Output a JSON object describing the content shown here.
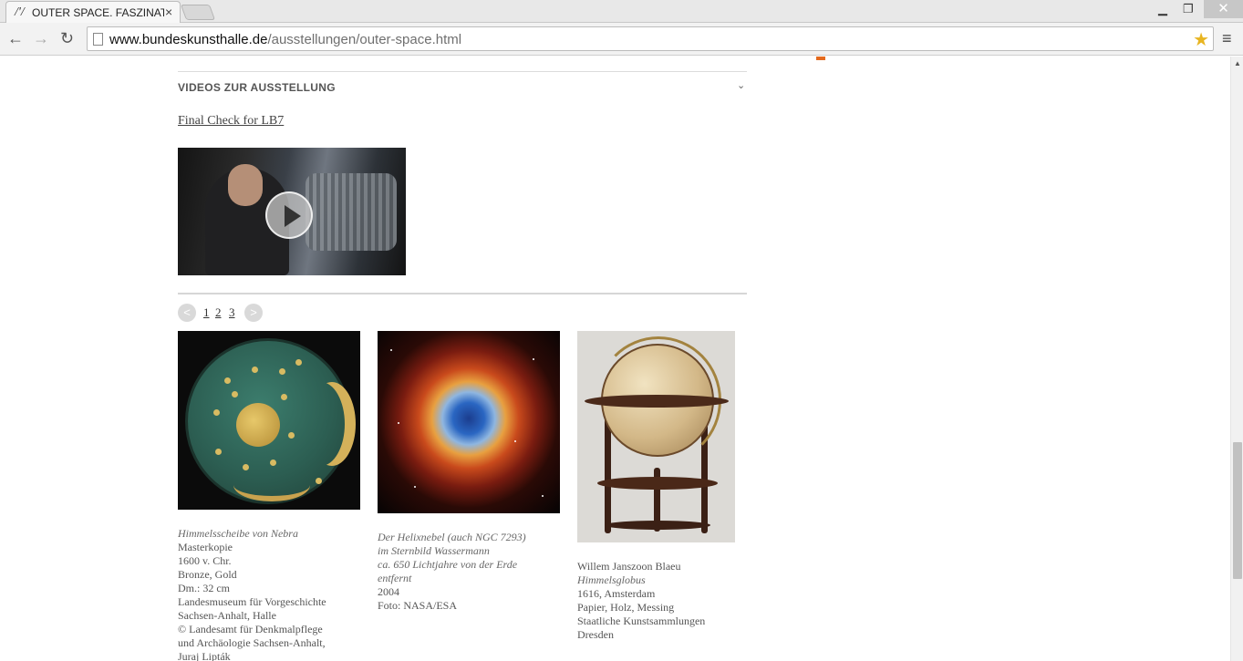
{
  "browser": {
    "tab_title": "OUTER SPACE. FASZINATI",
    "tab_favicon": "/'/",
    "url_host": "www.bundeskunsthalle.de",
    "url_path": "/ausstellungen/outer-space.html"
  },
  "section": {
    "title": "VIDEOS ZUR AUSSTELLUNG",
    "video_link": "Final Check for LB7"
  },
  "pager": {
    "prev": "<",
    "next": ">",
    "pages": [
      "1",
      "2",
      "3"
    ]
  },
  "artworks": [
    {
      "lines_italic": [
        "Himmelsscheibe von Nebra"
      ],
      "lines": [
        "Masterkopie",
        "1600 v. Chr.",
        "Bronze, Gold",
        "Dm.: 32 cm",
        "Landesmuseum für Vorgeschichte",
        "Sachsen-Anhalt, Halle",
        "© Landesamt für Denkmalpflege",
        "und Archäologie Sachsen-Anhalt,",
        "Juraj  Lipták"
      ]
    },
    {
      "lines_italic": [
        "Der Helixnebel (auch NGC 7293)",
        "im Sternbild Wassermann",
        "ca. 650 Lichtjahre von der Erde",
        "entfernt"
      ],
      "lines": [
        "2004",
        "Foto: NASA/ESA"
      ]
    },
    {
      "line_first": "Willem Janszoon Blaeu",
      "lines_italic": [
        "Himmelsglobus"
      ],
      "lines": [
        "1616, Amsterdam",
        "Papier, Holz, Messing",
        "Staatliche Kunstsammlungen",
        "Dresden"
      ]
    }
  ],
  "colors": {
    "accent": "#e46a1e",
    "star": "#e8b521"
  }
}
